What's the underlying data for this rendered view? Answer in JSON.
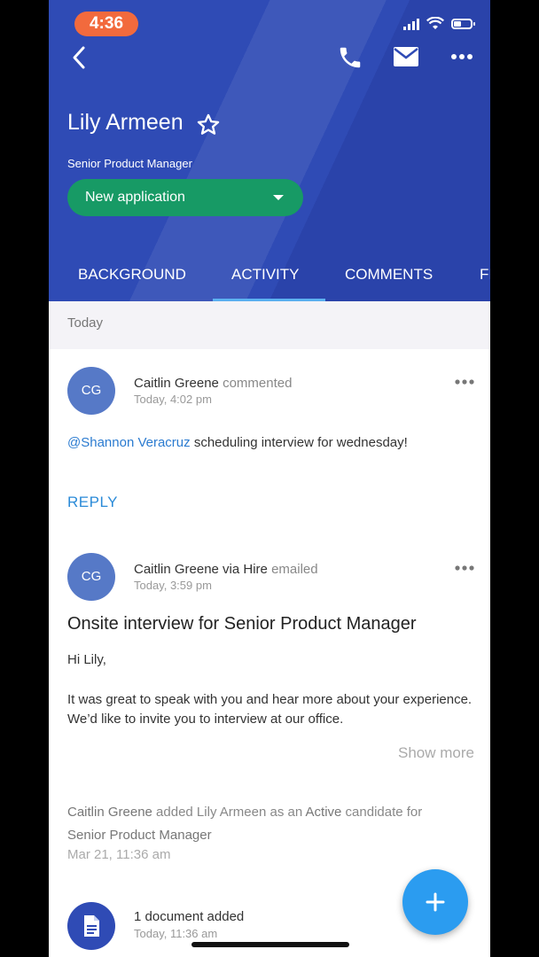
{
  "status_bar": {
    "time": "4:36"
  },
  "header": {
    "candidate_name": "Lily Armeen",
    "candidate_title": "Senior Product Manager",
    "status_label": "New application",
    "icons": [
      "back-icon",
      "phone-icon",
      "mail-icon",
      "more-icon",
      "star-icon"
    ]
  },
  "tabs": [
    "BACKGROUND",
    "ACTIVITY",
    "COMMENTS",
    "FI"
  ],
  "active_tab": "ACTIVITY",
  "feed": {
    "section_label": "Today",
    "comment": {
      "initials": "CG",
      "author": "Caitlin Greene",
      "verb": "commented",
      "time": "Today, 4:02 pm",
      "mention": "@Shannon Veracruz",
      "text": " scheduling interview for wednesday!",
      "reply_label": "REPLY"
    },
    "email": {
      "initials": "CG",
      "author": "Caitlin Greene via Hire",
      "verb": "emailed",
      "time": "Today, 3:59 pm",
      "subject": "Onsite interview for Senior Product Manager",
      "greeting": "Hi Lily,",
      "body": "It was great to speak with you and hear more about your experience. We’d like to invite you to interview at our office.",
      "show_more": "Show more"
    },
    "activity": {
      "actor": "Caitlin Greene",
      "text_1": " added Lily Armeen as an ",
      "state": "Active",
      "text_2": " candidate for ",
      "job": "Senior Product Manager",
      "time": "Mar 21, 11:36 am"
    },
    "document": {
      "title": "1 document added",
      "time": "Today, 11:36 am"
    }
  },
  "colors": {
    "header_bg": "#2f4bb5",
    "status_green": "#179a65",
    "accent_blue": "#2b9cf0",
    "avatar_bg": "#5679c7",
    "time_pill": "#f26a3d"
  }
}
